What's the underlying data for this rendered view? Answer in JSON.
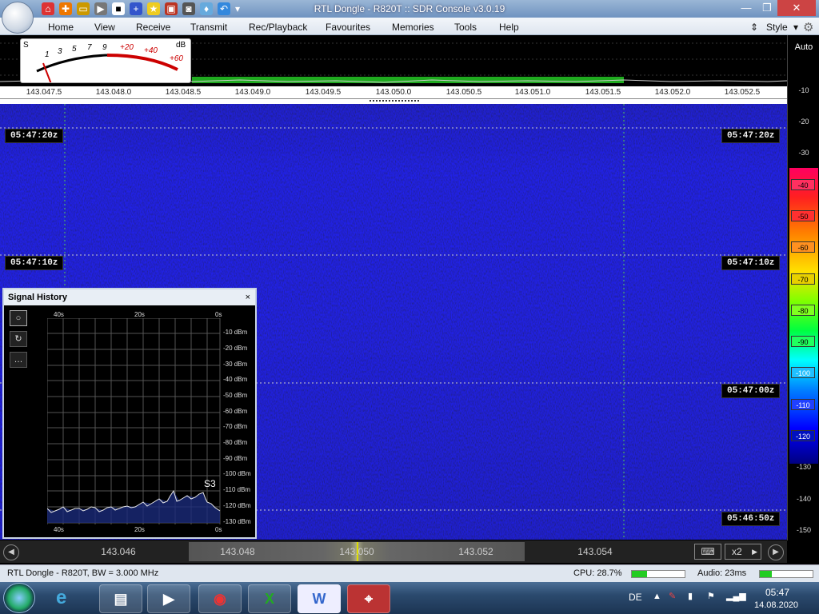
{
  "window": {
    "title": "RTL Dongle - R820T :: SDR Console v3.0.19"
  },
  "menu": {
    "items": [
      "Home",
      "View",
      "Receive",
      "Transmit",
      "Rec/Playback",
      "Favourites",
      "Memories",
      "Tools",
      "Help"
    ],
    "style_label": "Style"
  },
  "smeter": {
    "s_label": "S",
    "db_label": "dB",
    "ticks": [
      "1",
      "3",
      "5",
      "7",
      "9",
      "+20",
      "+40",
      "+60"
    ]
  },
  "freq_axis": {
    "labels": [
      "143.047.5",
      "143.048.0",
      "143.048.5",
      "143.049.0",
      "143.049.5",
      "143.050.0",
      "143.050.5",
      "143.051.0",
      "143.051.5",
      "143.052.0",
      "143.052.5"
    ]
  },
  "right_scale": {
    "auto_label": "Auto",
    "levels": [
      "-10",
      "-20",
      "-30",
      "-40",
      "-50",
      "-60",
      "-70",
      "-80",
      "-90",
      "-100",
      "-110",
      "-120",
      "-130",
      "-140",
      "-150"
    ]
  },
  "waterfall": {
    "times_left": [
      "05:47:20z",
      "05:47:10z"
    ],
    "times_right": [
      "05:47:20z",
      "05:47:10z",
      "05:47:00z",
      "05:46:50z"
    ]
  },
  "signal_history": {
    "title": "Signal History",
    "close": "×",
    "top_ticks": [
      "40s",
      "20s",
      "0s"
    ],
    "bottom_ticks": [
      "40s",
      "20s",
      "0s"
    ],
    "dbm": [
      "-10 dBm",
      "-20 dBm",
      "-30 dBm",
      "-40 dBm",
      "-50 dBm",
      "-60 dBm",
      "-70 dBm",
      "-80 dBm",
      "-90 dBm",
      "-100 dBm",
      "-110 dBm",
      "-120 dBm",
      "-130 dBm"
    ],
    "s_reading": "S3",
    "buttons": [
      "○",
      "↻",
      "…"
    ]
  },
  "tuning": {
    "labels": [
      "143.046",
      "143.048",
      "143.050",
      "143.052",
      "143.054"
    ],
    "zoom": "x2"
  },
  "status": {
    "device": "RTL Dongle - R820T, BW = 3.000 MHz",
    "cpu": "CPU: 28.7%",
    "audio": "Audio: 23ms",
    "cpu_level": 0.287,
    "audio_level": 0.23
  },
  "taskbar": {
    "lang": "DE",
    "time": "05:47",
    "date": "14.08.2020"
  },
  "colors": {
    "waterfall": "#0a0a88",
    "accent": "#2a4a7a"
  }
}
